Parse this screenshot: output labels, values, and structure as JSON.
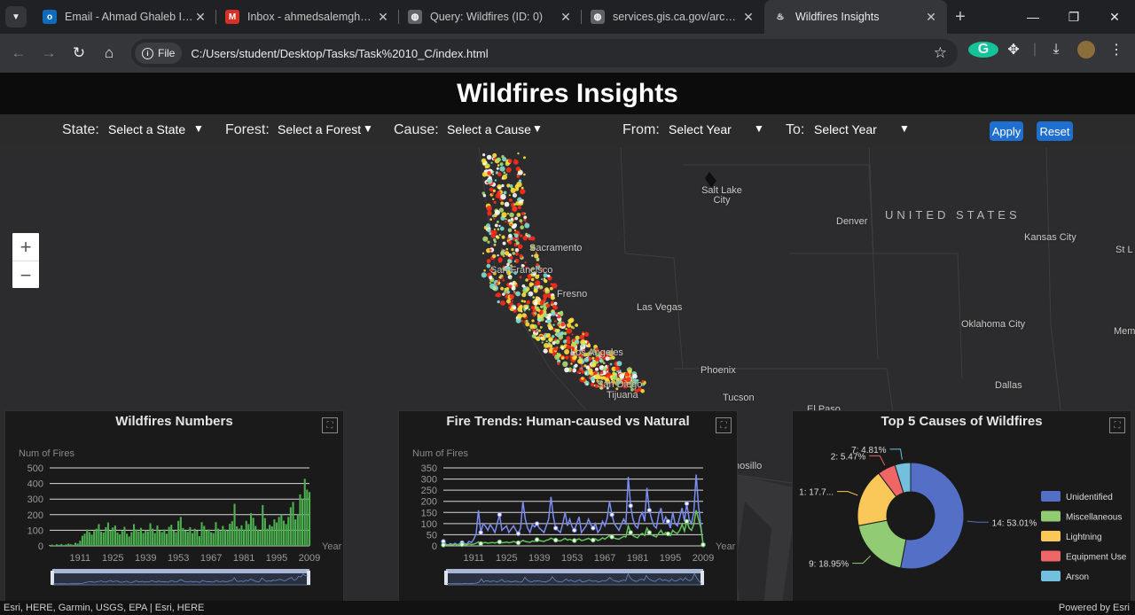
{
  "browser": {
    "tabs": [
      {
        "label": "Email - Ahmad Ghaleb Issa",
        "icon": "outlook-icon",
        "color": "#0f6cbd",
        "glyph": "o"
      },
      {
        "label": "Inbox - ahmedsalemghaleb",
        "icon": "gmail-icon",
        "color": "#d93025",
        "glyph": "M"
      },
      {
        "label": "Query: Wildfires (ID: 0)",
        "icon": "globe-icon",
        "color": "#5f6368",
        "glyph": "◍"
      },
      {
        "label": "services.gis.ca.gov/arcgis/re",
        "icon": "globe-icon",
        "color": "#5f6368",
        "glyph": "◍"
      },
      {
        "label": "Wildfires Insights",
        "icon": "fire-icon",
        "color": "#35363a",
        "glyph": "♨"
      }
    ],
    "address": {
      "chip": "File",
      "url": "C:/Users/student/Desktop/Tasks/Task%2010_C/index.html"
    }
  },
  "app": {
    "title": "Wildfires Insights",
    "filters": {
      "state_label": "State:",
      "state_value": "Select a State",
      "forest_label": "Forest:",
      "forest_value": "Select a Forest",
      "cause_label": "Cause:",
      "cause_value": "Select a Cause",
      "from_label": "From:",
      "from_value": "Select Year",
      "to_label": "To:",
      "to_value": "Select Year",
      "apply": "Apply",
      "reset": "Reset"
    }
  },
  "map": {
    "cities": [
      {
        "name": "Salt Lake City"
      },
      {
        "name": "Denver"
      },
      {
        "name": "Kansas City"
      },
      {
        "name": "St L"
      },
      {
        "name": "Sacramento"
      },
      {
        "name": "San Francisco"
      },
      {
        "name": "Fresno"
      },
      {
        "name": "Las Vegas"
      },
      {
        "name": "Oklahoma City"
      },
      {
        "name": "Mem"
      },
      {
        "name": "Los Angeles"
      },
      {
        "name": "Phoenix"
      },
      {
        "name": "San Diego"
      },
      {
        "name": "Tijuana"
      },
      {
        "name": "Tucson"
      },
      {
        "name": "Dallas"
      },
      {
        "name": "El Paso"
      },
      {
        "name": "nosillo"
      }
    ],
    "country": "UNITED STATES",
    "attribution": "Esri, HERE, Garmin, USGS, EPA | Esri, HERE",
    "powered": "Powered by Esri"
  },
  "chart_data": [
    {
      "type": "bar",
      "title": "Wildfires Numbers",
      "ylabel": "Num of Fires",
      "xlabel": "Year",
      "ylim": [
        0,
        500
      ],
      "yticks": [
        0,
        100,
        200,
        300,
        400,
        500
      ],
      "xticks": [
        "1911",
        "1925",
        "1939",
        "1953",
        "1967",
        "1981",
        "1995",
        "2009"
      ],
      "x_start": 1898,
      "x_end": 2009,
      "values": [
        6,
        8,
        4,
        10,
        7,
        12,
        5,
        9,
        14,
        11,
        8,
        20,
        15,
        33,
        65,
        78,
        105,
        88,
        72,
        95,
        110,
        140,
        92,
        85,
        120,
        150,
        98,
        118,
        130,
        86,
        74,
        95,
        122,
        78,
        60,
        88,
        140,
        105,
        92,
        115,
        82,
        100,
        93,
        145,
        110,
        82,
        130,
        96,
        88,
        105,
        78,
        122,
        135,
        98,
        88,
        160,
        185,
        115,
        98,
        90,
        120,
        82,
        110,
        98,
        62,
        152,
        128,
        98,
        105,
        88,
        82,
        152,
        110,
        95,
        128,
        105,
        98,
        142,
        158,
        270,
        125,
        110,
        132,
        105,
        160,
        140,
        210,
        180,
        128,
        105,
        98,
        262,
        178,
        110,
        135,
        125,
        170,
        150,
        185,
        205,
        162,
        140,
        185,
        248,
        282,
        170,
        205,
        330,
        300,
        430,
        360,
        345
      ]
    },
    {
      "type": "line",
      "title": "Fire Trends: Human-caused vs Natural",
      "ylabel": "Num of Fires",
      "xlabel": "Year",
      "ylim": [
        0,
        350
      ],
      "yticks": [
        0,
        50,
        100,
        150,
        200,
        250,
        300,
        350
      ],
      "xticks": [
        "1911",
        "1925",
        "1939",
        "1953",
        "1967",
        "1981",
        "1995",
        "2009"
      ],
      "x_start": 1898,
      "x_end": 2009,
      "series": [
        {
          "name": "Human-caused",
          "color": "#7b8cf2",
          "values": [
            20,
            8,
            4,
            10,
            6,
            12,
            5,
            9,
            14,
            10,
            8,
            20,
            15,
            30,
            55,
            160,
            60,
            100,
            88,
            70,
            95,
            80,
            60,
            100,
            140,
            70,
            80,
            90,
            60,
            75,
            90,
            70,
            55,
            80,
            200,
            120,
            80,
            60,
            95,
            85,
            100,
            80,
            70,
            60,
            90,
            120,
            220,
            130,
            80,
            70,
            60,
            100,
            150,
            90,
            120,
            85,
            70,
            100,
            130,
            60,
            75,
            90,
            120,
            95,
            80,
            100,
            60,
            75,
            110,
            90,
            125,
            200,
            140,
            100,
            85,
            70,
            95,
            120,
            100,
            310,
            180,
            120,
            90,
            80,
            130,
            150,
            110,
            260,
            160,
            120,
            90,
            80,
            140,
            170,
            100,
            130,
            110,
            80,
            150,
            100,
            90,
            130,
            170,
            110,
            190,
            120,
            100,
            150,
            320,
            180,
            90,
            5
          ]
        },
        {
          "name": "Natural",
          "color": "#63c45a",
          "values": [
            4,
            5,
            3,
            6,
            4,
            7,
            3,
            5,
            6,
            6,
            5,
            9,
            6,
            8,
            12,
            18,
            10,
            14,
            15,
            12,
            14,
            15,
            13,
            16,
            18,
            14,
            15,
            17,
            14,
            16,
            20,
            16,
            14,
            18,
            25,
            20,
            18,
            16,
            22,
            20,
            28,
            24,
            22,
            20,
            25,
            28,
            35,
            30,
            26,
            24,
            22,
            28,
            34,
            26,
            30,
            25,
            24,
            28,
            32,
            24,
            26,
            30,
            34,
            28,
            26,
            32,
            24,
            28,
            36,
            30,
            38,
            46,
            40,
            35,
            32,
            30,
            36,
            42,
            40,
            90,
            60,
            46,
            40,
            36,
            50,
            56,
            46,
            80,
            60,
            50,
            44,
            40,
            56,
            70,
            50,
            60,
            54,
            46,
            70,
            60,
            56,
            70,
            96,
            66,
            110,
            80,
            70,
            96,
            160,
            120,
            80,
            5
          ]
        }
      ]
    },
    {
      "type": "pie",
      "title": "Top 5 Causes of Wildfires",
      "labels": [
        "Unidentified",
        "Miscellaneous",
        "Lightning",
        "Equipment Use",
        "Arson"
      ],
      "values": [
        53.01,
        18.95,
        17.7,
        5.47,
        4.81
      ],
      "slice_labels": [
        "14: 53.01%",
        "9: 18.95%",
        "1: 17.7...",
        "2: 5.47%",
        "7: 4.81%"
      ],
      "colors": [
        "#5470c6",
        "#91cc75",
        "#fac858",
        "#ee6666",
        "#73c0de"
      ]
    }
  ]
}
